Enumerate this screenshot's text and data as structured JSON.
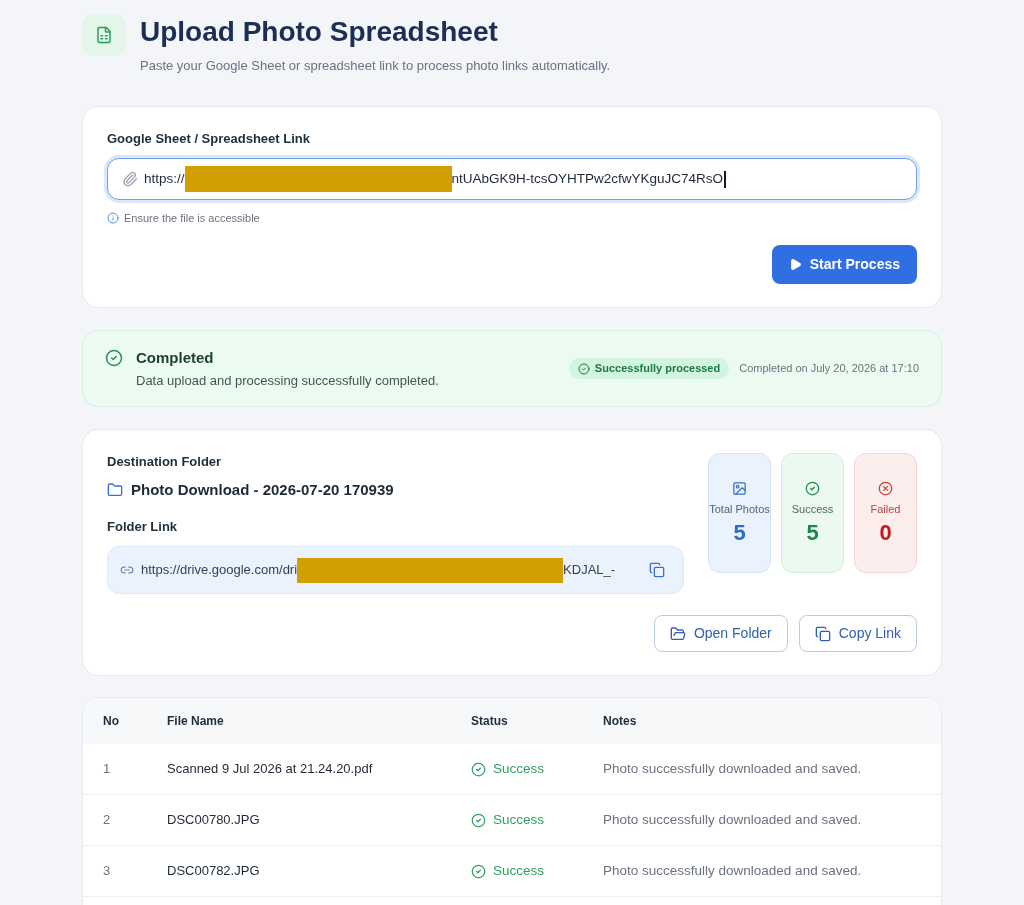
{
  "header": {
    "title": "Upload Photo Spreadsheet",
    "subtitle": "Paste your Google Sheet or spreadsheet link to process photo links automatically."
  },
  "link_form": {
    "label": "Google Sheet / Spreadsheet Link",
    "focused": true,
    "value_parts": [
      {
        "kind": "text",
        "text": "https://"
      },
      {
        "kind": "redacted"
      },
      {
        "kind": "text",
        "text": "ntUAbGK9H-tcsOYHTPw2cfwYKguJC74RsO"
      }
    ],
    "hint": "Ensure the file is accessible",
    "button": "Start Process"
  },
  "status": {
    "kind": "completed",
    "title": "Completed",
    "message": "Data upload and processing successfully completed.",
    "badge": "Successfully processed",
    "timestamp": "Completed on July 20, 2026 at 17:10"
  },
  "destination": {
    "label": "Destination Folder",
    "folder_name": "Photo Download - 2026-07-20 170939",
    "link_label": "Folder Link",
    "link_parts": [
      {
        "kind": "text",
        "text": "https://drive.google.com/dri"
      },
      {
        "kind": "redacted"
      },
      {
        "kind": "text",
        "text": "KDJAL_-"
      }
    ],
    "stats": [
      {
        "kind": "total",
        "label": "Total Photos",
        "value": "5"
      },
      {
        "kind": "success",
        "label": "Success",
        "value": "5"
      },
      {
        "kind": "failed",
        "label": "Failed",
        "value": "0"
      }
    ],
    "buttons": [
      {
        "kind": "open",
        "label": "Open Folder"
      },
      {
        "kind": "copy",
        "label": "Copy Link"
      }
    ]
  },
  "table": {
    "columns": [
      "No",
      "File Name",
      "Status",
      "Notes"
    ],
    "rows": [
      {
        "no": "1",
        "file_name": "Scanned 9 Jul 2026 at 21.24.20.pdf",
        "status": {
          "kind": "success",
          "label": "Success"
        },
        "notes": "Photo successfully downloaded and saved."
      },
      {
        "no": "2",
        "file_name": "DSC00780.JPG",
        "status": {
          "kind": "success",
          "label": "Success"
        },
        "notes": "Photo successfully downloaded and saved."
      },
      {
        "no": "3",
        "file_name": "DSC00782.JPG",
        "status": {
          "kind": "success",
          "label": "Success"
        },
        "notes": "Photo successfully downloaded and saved."
      }
    ]
  }
}
